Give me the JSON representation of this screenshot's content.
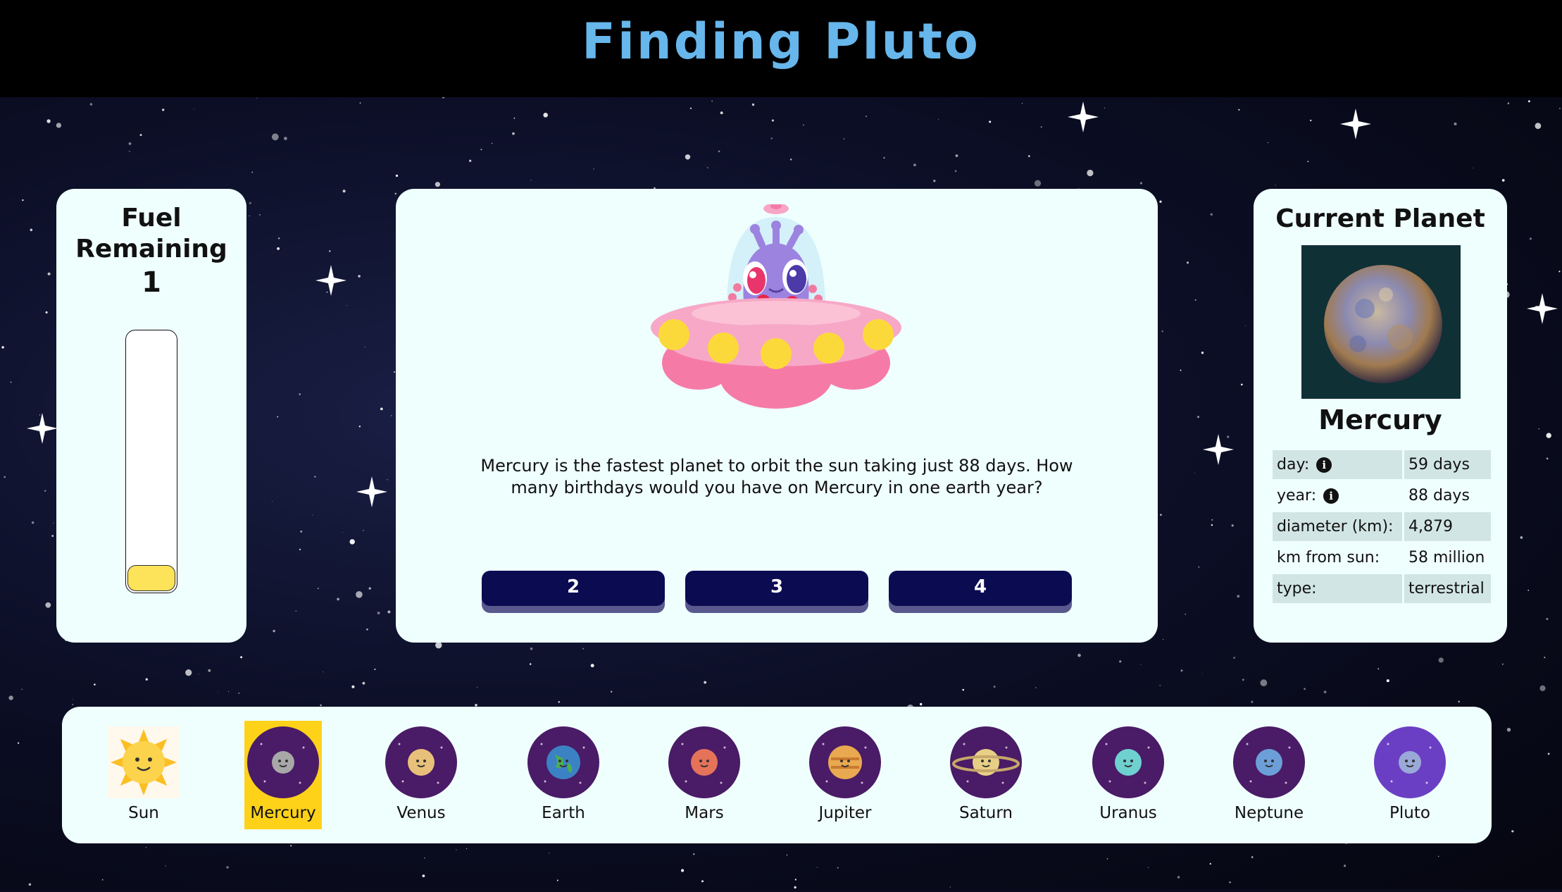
{
  "header": {
    "title": "Finding Pluto"
  },
  "fuel": {
    "title_line1": "Fuel",
    "title_line2": "Remaining",
    "value": "1",
    "level_fraction": 0.1
  },
  "question": {
    "text": "Mercury is the fastest planet to orbit the sun taking just 88 days. How many birthdays would you have on Mercury in one earth year?",
    "answers": [
      "2",
      "3",
      "4"
    ]
  },
  "current_planet": {
    "title": "Current Planet",
    "name": "Mercury",
    "facts": [
      {
        "label": "day:",
        "value": "59 days",
        "info": true
      },
      {
        "label": "year:",
        "value": "88 days",
        "info": true
      },
      {
        "label": "diameter (km):",
        "value": "4,879",
        "info": false
      },
      {
        "label": "km from sun:",
        "value": "58 million",
        "info": false
      },
      {
        "label": "type:",
        "value": "terrestrial",
        "info": false
      }
    ]
  },
  "planets": [
    {
      "name": "Sun",
      "icon": "sun-icon",
      "color": "#fbbf24",
      "selected": false
    },
    {
      "name": "Mercury",
      "icon": "mercury-icon",
      "color": "#a8a8a8",
      "selected": true
    },
    {
      "name": "Venus",
      "icon": "venus-icon",
      "color": "#e8c07a",
      "selected": false
    },
    {
      "name": "Earth",
      "icon": "earth-icon",
      "color": "#3b82c4",
      "selected": false
    },
    {
      "name": "Mars",
      "icon": "mars-icon",
      "color": "#e5735a",
      "selected": false
    },
    {
      "name": "Jupiter",
      "icon": "jupiter-icon",
      "color": "#e9a950",
      "selected": false
    },
    {
      "name": "Saturn",
      "icon": "saturn-icon",
      "color": "#e8cf86",
      "selected": false
    },
    {
      "name": "Uranus",
      "icon": "uranus-icon",
      "color": "#6fd0d0",
      "selected": false
    },
    {
      "name": "Neptune",
      "icon": "neptune-icon",
      "color": "#6c9fd8",
      "selected": false
    },
    {
      "name": "Pluto",
      "icon": "pluto-icon",
      "color": "#9aa9d8",
      "selected": false
    }
  ],
  "colors": {
    "header_title": "#67b6ec",
    "panel_bg": "#effffe",
    "button_bg": "#0b0b52",
    "fuel_fill": "#fde35a",
    "selected_planet_bg": "#ffd21a"
  }
}
